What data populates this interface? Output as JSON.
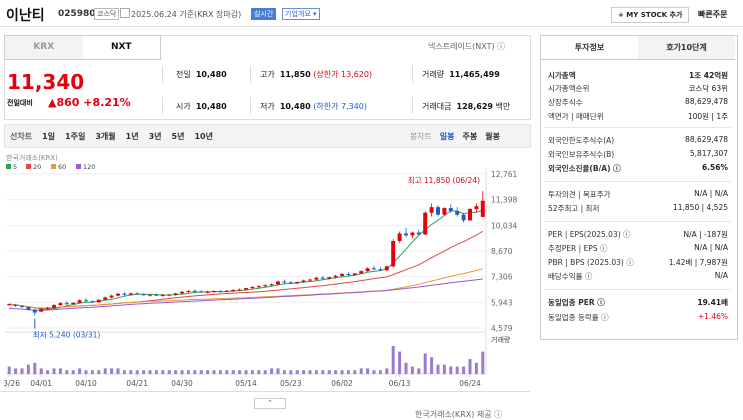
{
  "header": {
    "name": "이난티",
    "code": "025980",
    "market_badge": "코스닥",
    "date_text": "2025.06.24  기준(KRX 장마감)",
    "realtime_badge": "실시간",
    "company_badge": "기업개요 ▾",
    "mystock_button": "+ MY STOCK 추가",
    "quick_order": "빠른주문"
  },
  "tabs": {
    "krx": "KRX",
    "nxt": "NXT",
    "nxt_link": "넥스트레이드(NXT) ⓘ"
  },
  "quote": {
    "price": "11,340",
    "change_label": "전일대비",
    "change": "▲860",
    "change_pct": "+8.21%",
    "prev_label": "전일",
    "prev": "10,480",
    "high_label": "고가",
    "high": "11,850",
    "upper_limit": "(상한가 13,620)",
    "volume_label": "거래량",
    "volume": "11,465,499",
    "open_label": "시가",
    "open": "10,480",
    "low_label": "저가",
    "low": "10,480",
    "lower_limit": "(하한가 7,340)",
    "amount_label": "거래대금",
    "amount": "128,629",
    "amount_unit": "백만"
  },
  "periods": {
    "line": "선차트",
    "items": [
      "1일",
      "1주일",
      "3개월",
      "1년",
      "3년",
      "5년",
      "10년"
    ],
    "candle": "봉차트",
    "daily": "일봉",
    "weekly": "주봉",
    "monthly": "월봉"
  },
  "chart_data": {
    "type": "candlestick",
    "source_label": "한국거래소(KRX)",
    "legend": [
      {
        "name": "5",
        "color": "#2aa84a"
      },
      {
        "name": "20",
        "color": "#e04848"
      },
      {
        "name": "60",
        "color": "#e39a3a"
      },
      {
        "name": "120",
        "color": "#9a5ad1"
      }
    ],
    "y_ticks": [
      "12,761",
      "11,398",
      "10,034",
      "8,670",
      "7,306",
      "5,943",
      "4,579"
    ],
    "ylim": [
      4579,
      12761
    ],
    "x_ticks": [
      "03/26",
      "04/01",
      "04/10",
      "04/21",
      "04/30",
      "05/14",
      "05/23",
      "06/02",
      "06/13",
      "06/24"
    ],
    "high_annotation": "최고 11,850 (06/24)",
    "low_annotation": "최저 5,240 (03/31)",
    "volume_label": "거래량",
    "candles": [
      [
        5800,
        5880,
        5750,
        5850
      ],
      [
        5820,
        5860,
        5700,
        5750
      ],
      [
        5750,
        5780,
        5650,
        5700
      ],
      [
        5700,
        5720,
        5500,
        5550
      ],
      [
        5550,
        5600,
        5240,
        5400
      ],
      [
        5450,
        5650,
        5420,
        5600
      ],
      [
        5600,
        5700,
        5550,
        5650
      ],
      [
        5650,
        5850,
        5600,
        5800
      ],
      [
        5800,
        5950,
        5750,
        5900
      ],
      [
        5900,
        6000,
        5800,
        5850
      ],
      [
        5850,
        5950,
        5800,
        5920
      ],
      [
        5920,
        6100,
        5880,
        6050
      ],
      [
        6050,
        6150,
        5980,
        6000
      ],
      [
        6000,
        6050,
        5900,
        5950
      ],
      [
        5950,
        6100,
        5900,
        6080
      ],
      [
        6080,
        6250,
        6050,
        6200
      ],
      [
        6200,
        6350,
        6150,
        6300
      ],
      [
        6300,
        6450,
        6250,
        6400
      ],
      [
        6400,
        6500,
        6300,
        6350
      ],
      [
        6350,
        6450,
        6300,
        6420
      ],
      [
        6420,
        6480,
        6350,
        6380
      ],
      [
        6380,
        6420,
        6300,
        6320
      ],
      [
        6320,
        6400,
        6250,
        6350
      ],
      [
        6350,
        6420,
        6280,
        6300
      ],
      [
        6300,
        6380,
        6250,
        6330
      ],
      [
        6330,
        6400,
        6280,
        6350
      ],
      [
        6350,
        6450,
        6300,
        6420
      ],
      [
        6420,
        6550,
        6380,
        6500
      ],
      [
        6500,
        6600,
        6450,
        6550
      ],
      [
        6550,
        6620,
        6480,
        6520
      ],
      [
        6520,
        6600,
        6450,
        6480
      ],
      [
        6480,
        6560,
        6420,
        6500
      ],
      [
        6500,
        6580,
        6450,
        6540
      ],
      [
        6540,
        6600,
        6480,
        6520
      ],
      [
        6520,
        6600,
        6480,
        6560
      ],
      [
        6560,
        6650,
        6500,
        6600
      ],
      [
        6600,
        6680,
        6550,
        6620
      ],
      [
        6620,
        6720,
        6580,
        6700
      ],
      [
        6700,
        6800,
        6650,
        6760
      ],
      [
        6760,
        6850,
        6700,
        6800
      ],
      [
        6800,
        6900,
        6750,
        6850
      ],
      [
        6850,
        6950,
        6800,
        6900
      ],
      [
        6900,
        7100,
        6850,
        7050
      ],
      [
        7050,
        7150,
        6950,
        7000
      ],
      [
        7000,
        7080,
        6900,
        6950
      ],
      [
        6950,
        7050,
        6900,
        7020
      ],
      [
        7020,
        7150,
        6980,
        7100
      ],
      [
        7100,
        7200,
        7050,
        7150
      ],
      [
        7150,
        7300,
        7100,
        7250
      ],
      [
        7250,
        7350,
        7150,
        7200
      ],
      [
        7200,
        7300,
        7150,
        7280
      ],
      [
        7280,
        7400,
        7200,
        7350
      ],
      [
        7350,
        7500,
        7300,
        7450
      ],
      [
        7450,
        7550,
        7350,
        7400
      ],
      [
        7400,
        7500,
        7350,
        7480
      ],
      [
        7480,
        7650,
        7450,
        7600
      ],
      [
        7600,
        7800,
        7550,
        7750
      ],
      [
        7750,
        7900,
        7650,
        7700
      ],
      [
        7700,
        7800,
        7600,
        7650
      ],
      [
        7650,
        7900,
        7600,
        7850
      ],
      [
        7850,
        9300,
        7800,
        9200
      ],
      [
        9200,
        9700,
        9100,
        9600
      ],
      [
        9600,
        9900,
        9400,
        9500
      ],
      [
        9500,
        9700,
        9350,
        9650
      ],
      [
        9650,
        9800,
        9500,
        9550
      ],
      [
        9550,
        10800,
        9500,
        10700
      ],
      [
        10700,
        11200,
        10500,
        11000
      ],
      [
        11000,
        11100,
        10500,
        10600
      ],
      [
        10600,
        11000,
        10550,
        10950
      ],
      [
        10950,
        11150,
        10700,
        10800
      ],
      [
        10800,
        11000,
        10500,
        10600
      ],
      [
        10600,
        10700,
        10200,
        10300
      ],
      [
        10300,
        10950,
        10250,
        10900
      ],
      [
        10900,
        11200,
        10700,
        11050
      ],
      [
        10480,
        11850,
        10480,
        11340
      ]
    ],
    "volumes": [
      4,
      3,
      3,
      5,
      6,
      3,
      2,
      3,
      3,
      2,
      2,
      3,
      2,
      2,
      2,
      3,
      3,
      3,
      2,
      2,
      2,
      2,
      2,
      2,
      2,
      2,
      2,
      2,
      2,
      2,
      2,
      2,
      2,
      2,
      2,
      2,
      2,
      2,
      2,
      2,
      2,
      3,
      3,
      2,
      2,
      2,
      2,
      2,
      2,
      2,
      2,
      2,
      2,
      2,
      2,
      3,
      3,
      2,
      2,
      3,
      15,
      12,
      6,
      4,
      3,
      11,
      9,
      5,
      5,
      4,
      4,
      4,
      8,
      6,
      12
    ]
  },
  "invest": {
    "tab1": "투자정보",
    "tab2": "호가10단계",
    "rows": [
      {
        "label": "시가총액",
        "value": "1조 42억원",
        "bold": true
      },
      {
        "label": "시가총액순위",
        "value": "코스닥 63위"
      },
      {
        "label": "상장주식수",
        "value": "88,629,478"
      },
      {
        "label": "액면가 | 매매단위",
        "value": "100원 | 1주"
      },
      {
        "label": "외국인한도주식수(A)",
        "value": "88,629,478"
      },
      {
        "label": "외국인보유주식수(B)",
        "value": "5,817,307"
      },
      {
        "label": "외국인소진율(B/A) ⓘ",
        "value": "6.56%",
        "bold": true
      },
      {
        "label": "투자의견 | 목표주가",
        "value": "N/A | N/A"
      },
      {
        "label": "52주최고 | 최저",
        "value": "11,850 | 4,525"
      },
      {
        "label": "PER | EPS(2025.03) ⓘ",
        "value": "N/A | -187원"
      },
      {
        "label": "추정PER | EPS ⓘ",
        "value": "N/A | N/A"
      },
      {
        "label": "PBR | BPS (2025.03) ⓘ",
        "value": "1.42배 | 7,987원"
      },
      {
        "label": "배당수익률 ⓘ",
        "value": "N/A"
      },
      {
        "label": "동일업종 PER ⓘ",
        "value": "19.41배",
        "bold": true
      },
      {
        "label": "동일업종 등락률 ⓘ",
        "value": "+1.46%",
        "red": true
      }
    ]
  },
  "footer": {
    "handle": "⌃",
    "source": "한국거래소(KRX) 제공 ⓘ"
  }
}
